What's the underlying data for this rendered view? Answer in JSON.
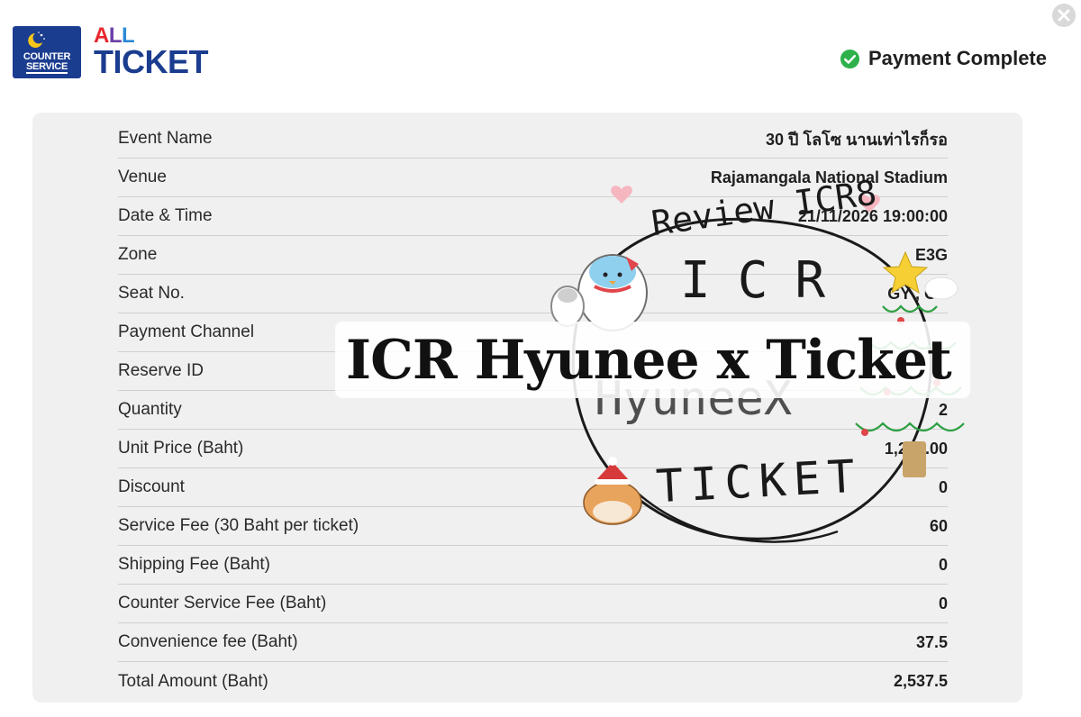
{
  "header": {
    "logo_line1": "COUNTER",
    "logo_line2": "SERVICE",
    "brand_top": "ALL",
    "brand_bottom": "TICKET",
    "status_text": "Payment Complete"
  },
  "colors": {
    "brand_blue": "#1b3d8f",
    "success_green": "#2eb14a",
    "card_bg": "#f0f0f0"
  },
  "icons": {
    "close": "close-icon",
    "status": "check-circle-icon",
    "logo": "moon-stars-icon"
  },
  "details": [
    {
      "label": "Event Name",
      "value": "30 ปี โลโซ นานเท่าไรก็รอ"
    },
    {
      "label": "Venue",
      "value": "Rajamangala National Stadium"
    },
    {
      "label": "Date & Time",
      "value": "21/11/2026 19:00:00"
    },
    {
      "label": "Zone",
      "value": "E3G"
    },
    {
      "label": "Seat No.",
      "value": "GY , GY"
    },
    {
      "label": "Payment Channel",
      "value": ""
    },
    {
      "label": "Reserve ID",
      "value": ""
    },
    {
      "label": "Quantity",
      "value": "2"
    },
    {
      "label": "Unit Price (Baht)",
      "value": "1,220.00"
    },
    {
      "label": "Discount",
      "value": "0"
    },
    {
      "label": "Service Fee (30 Baht per ticket)",
      "value": "60"
    },
    {
      "label": "Shipping Fee (Baht)",
      "value": "0"
    },
    {
      "label": "Counter Service Fee (Baht)",
      "value": "0"
    },
    {
      "label": "Convenience fee (Baht)",
      "value": "37.5"
    },
    {
      "label": "Total Amount (Baht)",
      "value": "2,537.5"
    }
  ],
  "watermark": {
    "banner_text": "ICR Hyunee x Ticket",
    "stamp_top": "Review ICR8",
    "stamp_line1": "ICR",
    "stamp_line2": "HyuneeX",
    "stamp_line3": "TICKET"
  }
}
